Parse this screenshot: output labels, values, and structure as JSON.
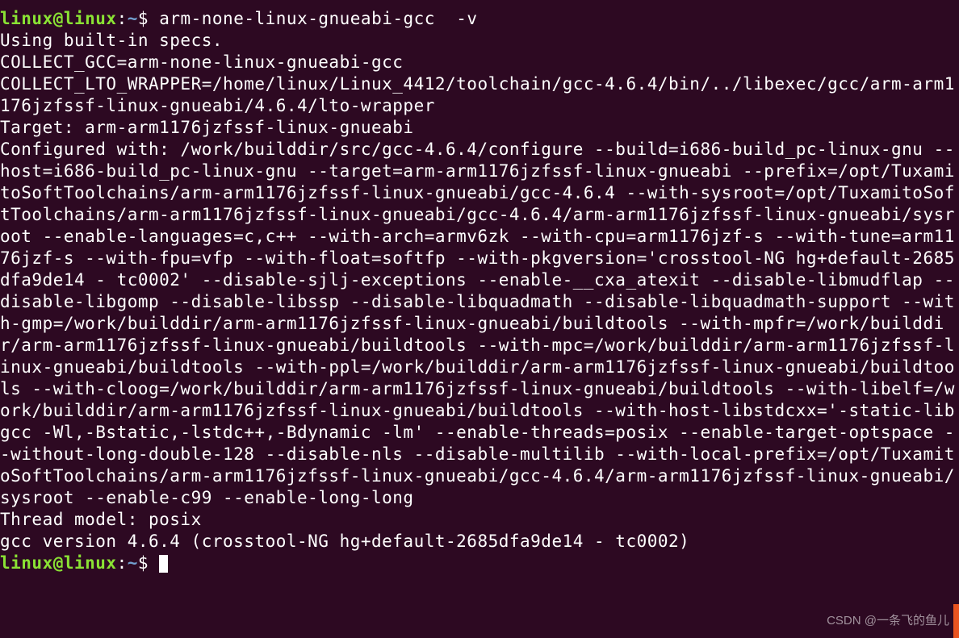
{
  "prompt": {
    "user_host": "linux@linux",
    "colon": ":",
    "path": "~",
    "dollar": "$"
  },
  "command": "arm-none-linux-gnueabi-gcc  -v",
  "output_lines": {
    "l1": "Using built-in specs.",
    "l2": "COLLECT_GCC=arm-none-linux-gnueabi-gcc",
    "l3": "COLLECT_LTO_WRAPPER=/home/linux/Linux_4412/toolchain/gcc-4.6.4/bin/../libexec/gcc/arm-arm1176jzfssf-linux-gnueabi/4.6.4/lto-wrapper",
    "l4": "Target: arm-arm1176jzfssf-linux-gnueabi",
    "l5": "Configured with: /work/builddir/src/gcc-4.6.4/configure --build=i686-build_pc-linux-gnu --host=i686-build_pc-linux-gnu --target=arm-arm1176jzfssf-linux-gnueabi --prefix=/opt/TuxamitoSoftToolchains/arm-arm1176jzfssf-linux-gnueabi/gcc-4.6.4 --with-sysroot=/opt/TuxamitoSoftToolchains/arm-arm1176jzfssf-linux-gnueabi/gcc-4.6.4/arm-arm1176jzfssf-linux-gnueabi/sysroot --enable-languages=c,c++ --with-arch=armv6zk --with-cpu=arm1176jzf-s --with-tune=arm1176jzf-s --with-fpu=vfp --with-float=softfp --with-pkgversion='crosstool-NG hg+default-2685dfa9de14 - tc0002' --disable-sjlj-exceptions --enable-__cxa_atexit --disable-libmudflap --disable-libgomp --disable-libssp --disable-libquadmath --disable-libquadmath-support --with-gmp=/work/builddir/arm-arm1176jzfssf-linux-gnueabi/buildtools --with-mpfr=/work/builddir/arm-arm1176jzfssf-linux-gnueabi/buildtools --with-mpc=/work/builddir/arm-arm1176jzfssf-linux-gnueabi/buildtools --with-ppl=/work/builddir/arm-arm1176jzfssf-linux-gnueabi/buildtools --with-cloog=/work/builddir/arm-arm1176jzfssf-linux-gnueabi/buildtools --with-libelf=/work/builddir/arm-arm1176jzfssf-linux-gnueabi/buildtools --with-host-libstdcxx='-static-libgcc -Wl,-Bstatic,-lstdc++,-Bdynamic -lm' --enable-threads=posix --enable-target-optspace --without-long-double-128 --disable-nls --disable-multilib --with-local-prefix=/opt/TuxamitoSoftToolchains/arm-arm1176jzfssf-linux-gnueabi/gcc-4.6.4/arm-arm1176jzfssf-linux-gnueabi/sysroot --enable-c99 --enable-long-long",
    "l6": "Thread model: posix",
    "l7": "gcc version 4.6.4 (crosstool-NG hg+default-2685dfa9de14 - tc0002)"
  },
  "watermark": "CSDN @一条飞的鱼儿"
}
